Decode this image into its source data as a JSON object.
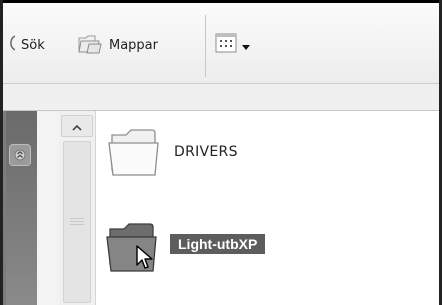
{
  "toolbar": {
    "search_label": "Sök",
    "folders_label": "Mappar",
    "views_icon": "view-menu-icon"
  },
  "content": {
    "items": [
      {
        "label": "DRIVERS",
        "icon": "folder-icon",
        "selected": false
      },
      {
        "label": "Light-utbXP",
        "icon": "folder-icon",
        "selected": true
      }
    ]
  }
}
